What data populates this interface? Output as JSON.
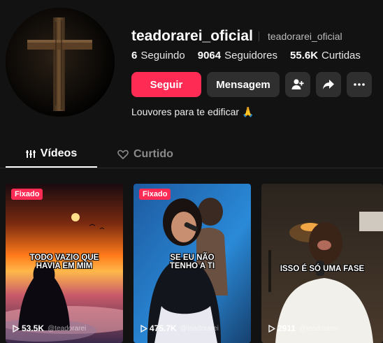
{
  "profile": {
    "username": "teadorarei_oficial",
    "nickname": "teadorarei_oficial",
    "bio": "Louvores para te edificar 🙏",
    "avatar_icon": "cross-icon"
  },
  "stats": [
    {
      "value": "6",
      "label": "Seguindo"
    },
    {
      "value": "9064",
      "label": "Seguidores"
    },
    {
      "value": "55.6K",
      "label": "Curtidas"
    }
  ],
  "actions": {
    "follow_label": "Seguir",
    "message_label": "Mensagem",
    "add_friend_icon": "add-user-icon",
    "share_icon": "share-arrow-icon",
    "more_icon": "more-icon"
  },
  "tabs": {
    "videos": "Vídeos",
    "liked": "Curtido"
  },
  "videos": [
    {
      "badge": "Fixado",
      "caption_line1": "TODO VAZIO QUE",
      "caption_line2": "HAVIA EM MIM",
      "views": "53.5K",
      "watermark": "@teadorarei"
    },
    {
      "badge": "Fixado",
      "caption_line1": "SE EU NÃO",
      "caption_line2": "TENHO A TI",
      "views": "475.7K",
      "watermark": "@teadorarei"
    },
    {
      "badge": "",
      "caption_line1": "ISSO É SÓ UMA FASE",
      "caption_line2": "",
      "views": "2911",
      "watermark": "@teadorarei"
    }
  ],
  "colors": {
    "accent": "#fe2c55",
    "background": "#121212",
    "button_secondary": "#2f2f2f"
  }
}
